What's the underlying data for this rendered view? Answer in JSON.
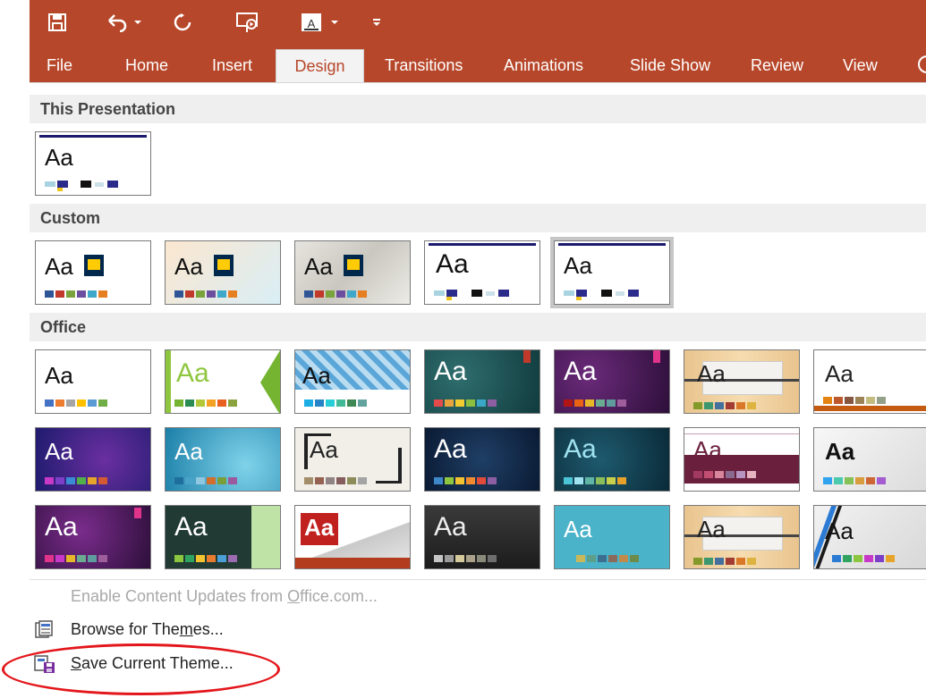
{
  "ribbon": {
    "qat": [
      {
        "name": "save-icon"
      },
      {
        "name": "undo-icon"
      },
      {
        "name": "redo-icon"
      },
      {
        "name": "present-icon"
      },
      {
        "name": "font-color-icon"
      },
      {
        "name": "customize-qat-icon"
      }
    ],
    "tabs": [
      "File",
      "Home",
      "Insert",
      "Design",
      "Transitions",
      "Animations",
      "Slide Show",
      "Review",
      "View"
    ],
    "active_tab": "Design",
    "accent": "#b7472a"
  },
  "sections": {
    "this_presentation": "This Presentation",
    "custom": "Custom",
    "office": "Office"
  },
  "thumb_label": "Aa",
  "menu": {
    "enable_updates": {
      "text": "Enable Content Updates from Office.com...",
      "underline": "O",
      "enabled": false
    },
    "browse": {
      "text": "Browse for Themes...",
      "underline": "m"
    },
    "save": {
      "text": "Save Current Theme...",
      "underline": "S"
    }
  },
  "annotation_color": "#e3161b"
}
